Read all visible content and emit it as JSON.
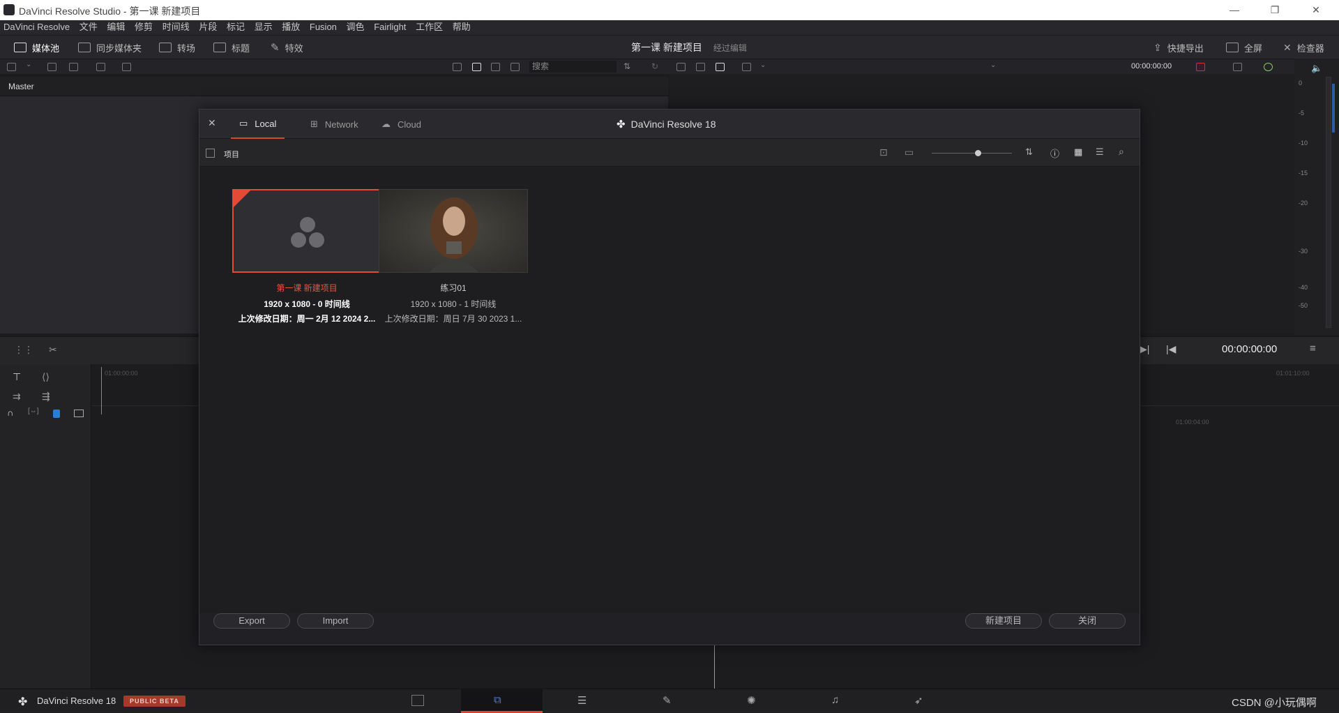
{
  "window": {
    "title": "DaVinci Resolve Studio - 第一课 新建项目",
    "controls": [
      "minimize-icon",
      "restore-icon",
      "close-icon"
    ]
  },
  "menu": [
    "DaVinci Resolve",
    "文件",
    "编辑",
    "修剪",
    "时间线",
    "片段",
    "标记",
    "显示",
    "播放",
    "Fusion",
    "调色",
    "Fairlight",
    "工作区",
    "帮助"
  ],
  "toolbar": {
    "media_pool": "媒体池",
    "sync_bin": "同步媒体夹",
    "transitions": "转场",
    "titles": "标题",
    "effects": "特效",
    "project_name": "第一课 新建项目",
    "edited": "经过编辑",
    "quick_export": "快捷导出",
    "fullscreen": "全屏",
    "inspector": "检查器"
  },
  "media_pool": {
    "search_placeholder": "搜索",
    "bin": "Master"
  },
  "viewer": {
    "timecode_top": "00:00:00:00",
    "timecode": "00:00:00:00"
  },
  "meters": {
    "scale": [
      "0",
      "-5",
      "-10",
      "-15",
      "-20",
      "-30",
      "-40",
      "-50"
    ]
  },
  "timeline": {
    "ruler_start": "01:00:00:00",
    "ruler_mid": "01:01:10:00",
    "ruler_mark": "01:00:04:00"
  },
  "dialog": {
    "tabs": {
      "local": "Local",
      "network": "Network",
      "cloud": "Cloud"
    },
    "title": "DaVinci Resolve 18",
    "section": "项目",
    "projects": [
      {
        "name": "第一课 新建项目",
        "resolution": "1920 x 1080 - 0 时间线",
        "modified": "上次修改日期：周一 2月 12 2024 2..."
      },
      {
        "name": "练习01",
        "resolution": "1920 x 1080 - 1 时间线",
        "modified": "上次修改日期：周日 7月 30 2023 1..."
      }
    ],
    "buttons": {
      "export": "Export",
      "import": "Import",
      "new_project": "新建项目",
      "close": "关闭"
    }
  },
  "pagebar": {
    "brand": "DaVinci Resolve 18",
    "beta": "PUBLIC BETA",
    "watermark": "CSDN @小玩偶啊"
  },
  "colors": {
    "accent": "#d9472f",
    "background": "#1c1c1f",
    "beta_badge": "#a43a2b"
  }
}
